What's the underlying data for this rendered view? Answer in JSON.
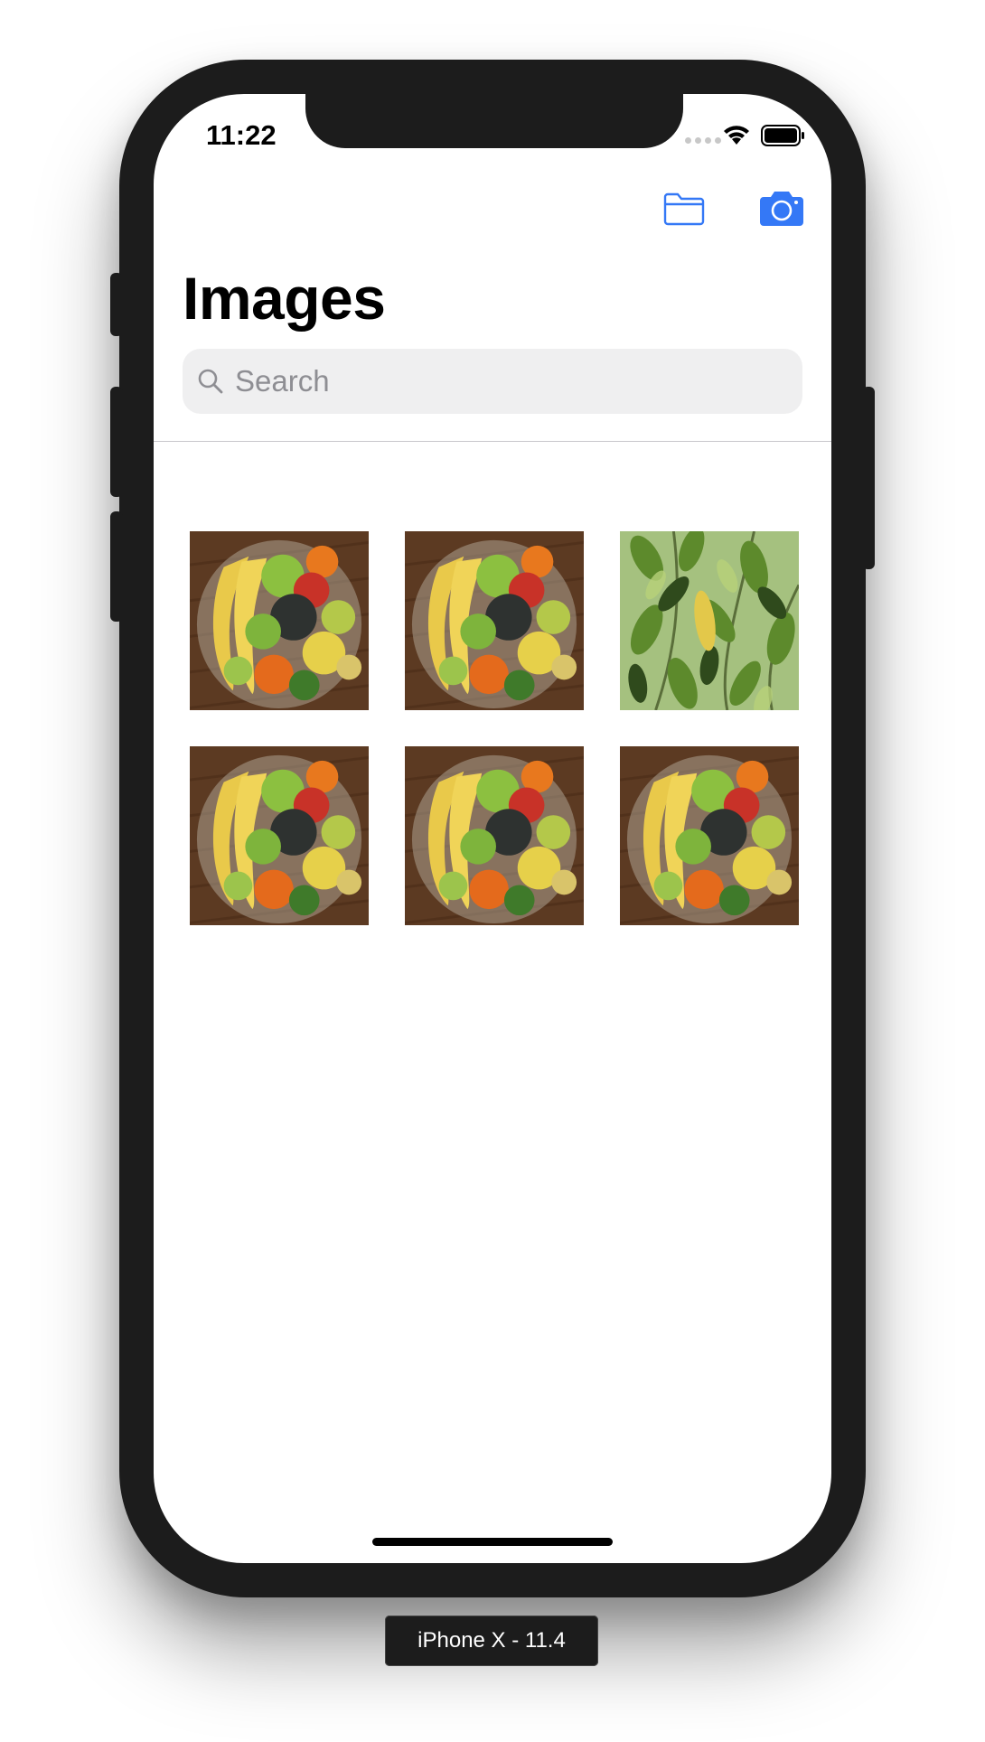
{
  "status_bar": {
    "time": "11:22",
    "icons": [
      "cellular-signal-icon",
      "wifi-icon",
      "battery-icon"
    ]
  },
  "nav_bar": {
    "buttons": [
      {
        "icon": "folder-icon",
        "action": "open-folder"
      },
      {
        "icon": "camera-icon",
        "action": "take-photo"
      }
    ],
    "accent_color": "#3478f6"
  },
  "page": {
    "title": "Images"
  },
  "search": {
    "placeholder": "Search",
    "value": ""
  },
  "gallery": {
    "columns": 3,
    "items": [
      {
        "subject": "fruit-bowl"
      },
      {
        "subject": "fruit-bowl"
      },
      {
        "subject": "green-leaves-plant"
      },
      {
        "subject": "fruit-bowl"
      },
      {
        "subject": "fruit-bowl"
      },
      {
        "subject": "fruit-bowl"
      }
    ]
  },
  "simulator": {
    "device_label": "iPhone X - 11.4"
  }
}
